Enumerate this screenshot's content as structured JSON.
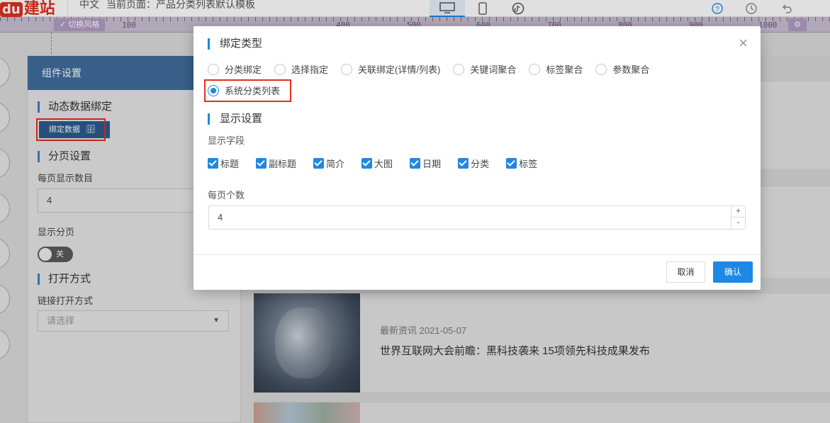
{
  "topbar": {
    "logo_mark": "du",
    "logo_text": "建站",
    "language": "中文",
    "current_page": "当前页面：产品分类列表默认模板",
    "devices": [
      "desktop-icon",
      "mobile-icon",
      "tiktok-icon"
    ],
    "tools": [
      "help-icon",
      "history-icon",
      "undo-icon"
    ]
  },
  "ruler": {
    "switch_style_label": "✓ 切换风格",
    "labels": [
      "100",
      "400",
      "500",
      "600",
      "700",
      "800",
      "900",
      "1000"
    ],
    "end_button": "⚙"
  },
  "panel": {
    "title": "组件设置",
    "dynamic_binding_title": "动态数据绑定",
    "bind_button": "绑定数据",
    "pagination_title": "分页设置",
    "per_page_label": "每页显示数目",
    "per_page_value": "4",
    "show_pagination_label": "显示分页",
    "toggle_state": "关",
    "open_mode_title": "打开方式",
    "link_open_label": "链接打开方式",
    "select_placeholder": "请选择"
  },
  "preview": {
    "article_meta": "最新资讯 2021-05-07",
    "article_title": "世界互联网大会前瞻：黑科技袭来 15项领先科技成果发布"
  },
  "modal": {
    "bind_type_title": "绑定类型",
    "bind_types": [
      {
        "label": "分类绑定",
        "checked": false
      },
      {
        "label": "选择指定",
        "checked": false
      },
      {
        "label": "关联绑定(详情/列表)",
        "checked": false
      },
      {
        "label": "关键词聚合",
        "checked": false
      },
      {
        "label": "标签聚合",
        "checked": false
      },
      {
        "label": "参数聚合",
        "checked": false
      },
      {
        "label": "系统分类列表",
        "checked": true
      }
    ],
    "display_title": "显示设置",
    "display_fields_label": "显示字段",
    "fields": [
      "标题",
      "副标题",
      "简介",
      "大图",
      "日期",
      "分类",
      "标签"
    ],
    "per_page_label": "每页个数",
    "per_page_value": "4",
    "stepper_up": "+",
    "stepper_down": "-",
    "cancel": "取消",
    "confirm": "确认",
    "close": "×"
  },
  "colors": {
    "accent": "#1e88e5",
    "highlight": "#e0301e",
    "panel_header": "#3f6d9c"
  }
}
